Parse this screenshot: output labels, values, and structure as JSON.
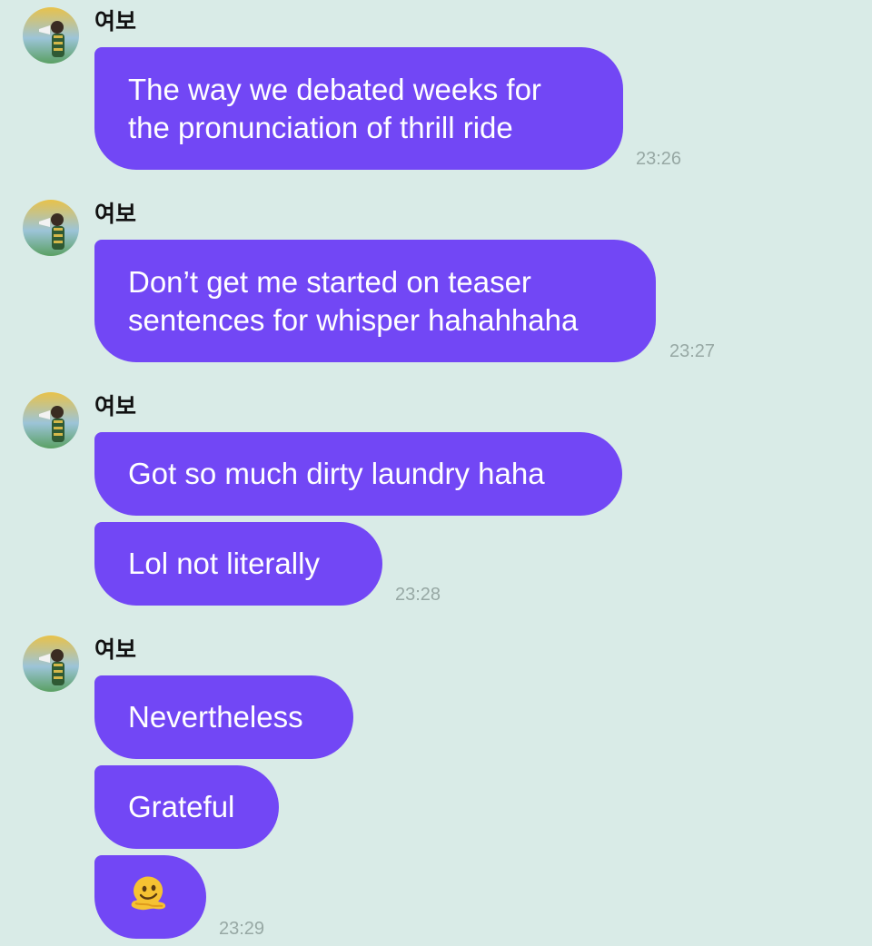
{
  "chat": {
    "groups": [
      {
        "sender": "여보",
        "messages": [
          {
            "line1": "The way we debated weeks for",
            "line2": "the pronunciation of thrill ride"
          }
        ],
        "time": "23:26"
      },
      {
        "sender": "여보",
        "messages": [
          {
            "line1": "Don’t get me started on teaser",
            "line2": "sentences for whisper hahahhaha"
          }
        ],
        "time": "23:27"
      },
      {
        "sender": "여보",
        "messages": [
          {
            "text": "Got so much dirty laundry haha"
          },
          {
            "text": "Lol not literally"
          }
        ],
        "time": "23:28"
      },
      {
        "sender": "여보",
        "messages": [
          {
            "text": "Nevertheless"
          },
          {
            "text": "Grateful"
          },
          {
            "emoji": "melting-face-emoji"
          }
        ],
        "time": "23:29"
      }
    ]
  },
  "colors": {
    "background": "#d9ebe7",
    "bubble": "#7247f5",
    "bubble_text": "#ffffff",
    "timestamp": "#97a8a4"
  },
  "icons": {
    "avatar": "profile-photo-avatar"
  }
}
